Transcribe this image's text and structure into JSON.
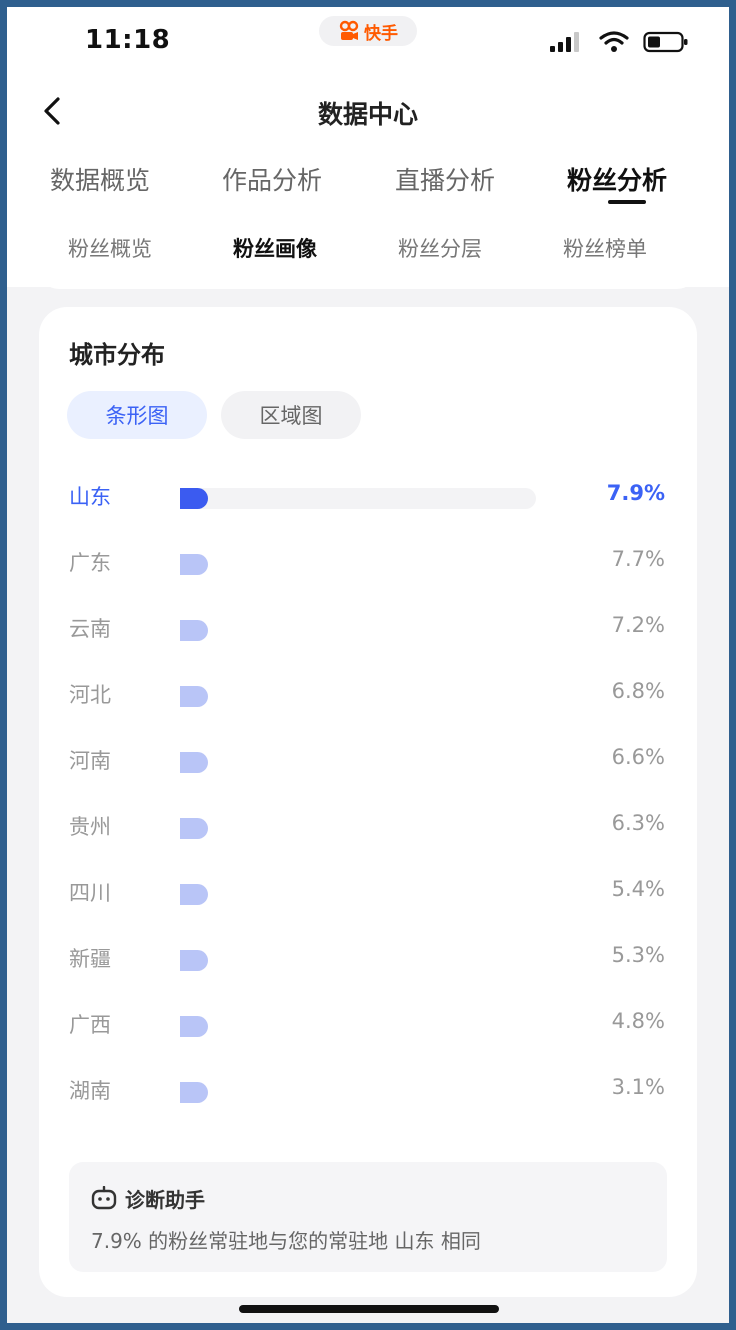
{
  "status_bar": {
    "time": "11:18",
    "app_name": "快手",
    "app_brand_color": "#ff5a00",
    "icons": [
      "signal-icon",
      "wifi-icon",
      "battery-icon"
    ]
  },
  "header": {
    "title": "数据中心",
    "back_icon": "chevron-left-icon"
  },
  "main_tabs": [
    {
      "label": "数据概览",
      "active": false
    },
    {
      "label": "作品分析",
      "active": false
    },
    {
      "label": "直播分析",
      "active": false
    },
    {
      "label": "粉丝分析",
      "active": true
    }
  ],
  "sub_tabs": [
    {
      "label": "粉丝概览",
      "active": false
    },
    {
      "label": "粉丝画像",
      "active": true
    },
    {
      "label": "粉丝分层",
      "active": false
    },
    {
      "label": "粉丝榜单",
      "active": false
    }
  ],
  "city_card": {
    "title": "城市分布",
    "view_toggles": [
      {
        "label": "条形图",
        "selected": true
      },
      {
        "label": "区域图",
        "selected": false
      }
    ],
    "accent_color": "#3b62f5",
    "items": [
      {
        "name": "山东",
        "percent_text": "7.9%",
        "percent": 7.9,
        "highlight": true
      },
      {
        "name": "广东",
        "percent_text": "7.7%",
        "percent": 7.7,
        "highlight": false
      },
      {
        "name": "云南",
        "percent_text": "7.2%",
        "percent": 7.2,
        "highlight": false
      },
      {
        "name": "河北",
        "percent_text": "6.8%",
        "percent": 6.8,
        "highlight": false
      },
      {
        "name": "河南",
        "percent_text": "6.6%",
        "percent": 6.6,
        "highlight": false
      },
      {
        "name": "贵州",
        "percent_text": "6.3%",
        "percent": 6.3,
        "highlight": false
      },
      {
        "name": "四川",
        "percent_text": "5.4%",
        "percent": 5.4,
        "highlight": false
      },
      {
        "name": "新疆",
        "percent_text": "5.3%",
        "percent": 5.3,
        "highlight": false
      },
      {
        "name": "广西",
        "percent_text": "4.8%",
        "percent": 4.8,
        "highlight": false
      },
      {
        "name": "湖南",
        "percent_text": "3.1%",
        "percent": 3.1,
        "highlight": false
      }
    ],
    "diagnosis": {
      "icon": "robot-icon",
      "title": "诊断助手",
      "text": "7.9% 的粉丝常驻地与您的常驻地 山东 相同"
    }
  }
}
